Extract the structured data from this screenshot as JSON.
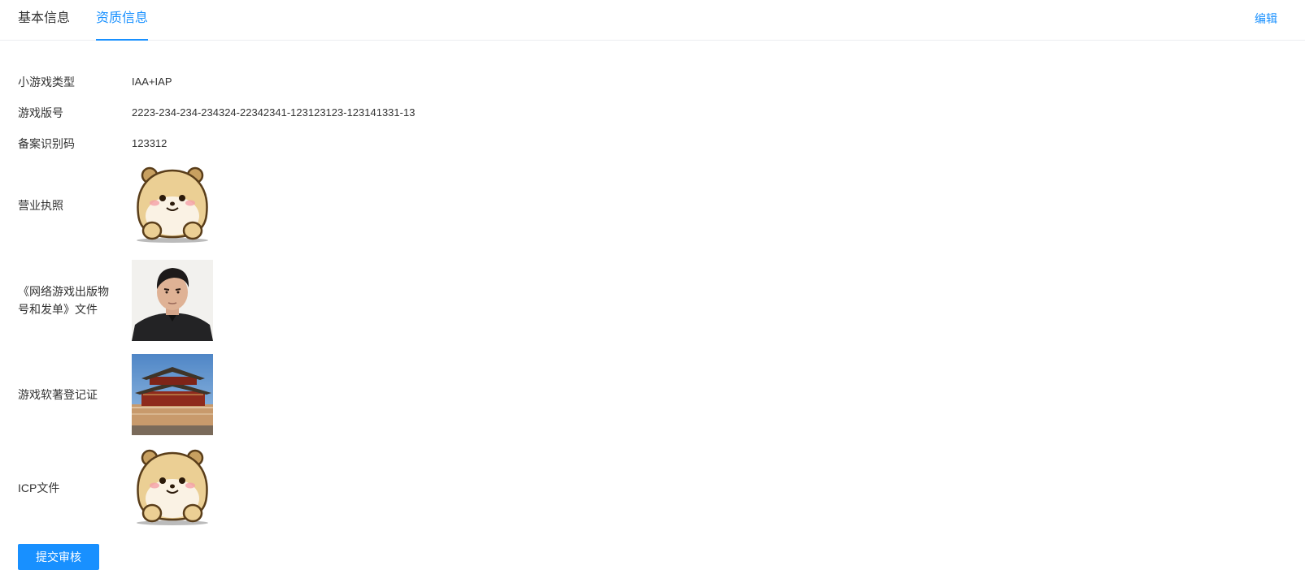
{
  "tabs": [
    {
      "label": "基本信息",
      "active": false
    },
    {
      "label": "资质信息",
      "active": true
    }
  ],
  "header": {
    "edit_label": "编辑"
  },
  "accent_color": "#1890ff",
  "fields": {
    "game_type": {
      "label": "小游戏类型",
      "value": "IAA+IAP"
    },
    "version_no": {
      "label": "游戏版号",
      "value": "2223-234-234-234324-22342341-123123123-123141331-13"
    },
    "record_code": {
      "label": "备案识别码",
      "value": "123312"
    },
    "business_license": {
      "label": "营业执照",
      "image": "hamster-cartoon-image"
    },
    "publication_doc": {
      "label_line1": "《网络游戏出版物",
      "label_line2": "号和发单》文件",
      "image": "portrait-photo-image"
    },
    "software_copyright": {
      "label": "游戏软著登记证",
      "image": "palace-photo-image"
    },
    "icp_doc": {
      "label": "ICP文件",
      "image": "hamster-cartoon-image"
    }
  },
  "submit_label": "提交审核"
}
